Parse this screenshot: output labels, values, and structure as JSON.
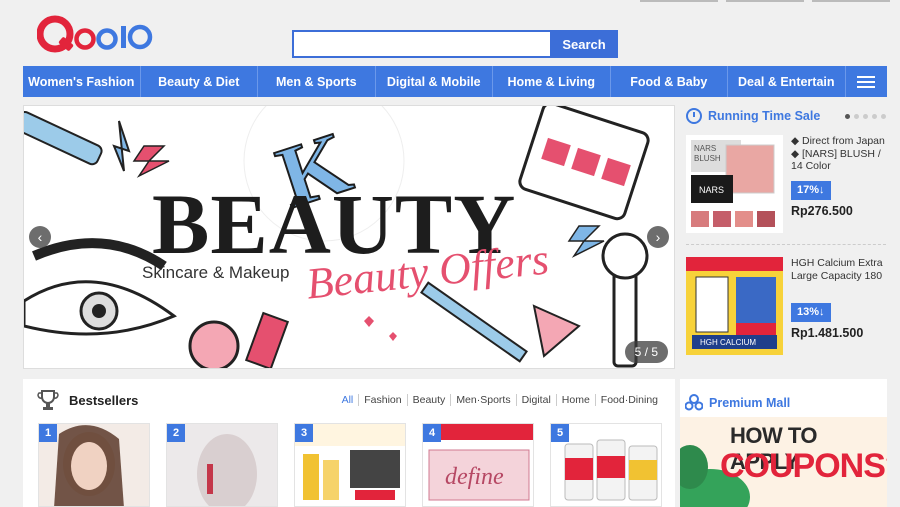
{
  "header": {
    "logo": "Qoo10",
    "search": {
      "value": "",
      "placeholder": "",
      "button_label": "Search"
    }
  },
  "nav": {
    "items": [
      "Women's Fashion",
      "Beauty & Diet",
      "Men & Sports",
      "Digital & Mobile",
      "Home & Living",
      "Food & Baby",
      "Deal & Entertain"
    ],
    "menu_icon": "hamburger-icon"
  },
  "banner": {
    "k_letter": "K",
    "title": "BEAUTY",
    "subtitle": "Skincare & Makeup",
    "offer": "Beauty Offers",
    "counter": "5 / 5"
  },
  "running_sale": {
    "title": "Running Time Sale",
    "items": [
      {
        "desc": "◆ Direct from Japan ◆ [NARS] BLUSH / 14 Color",
        "discount": "17%↓",
        "price": "Rp276.500",
        "img_text": "NARS BLUSH"
      },
      {
        "desc": "HGH Calcium Extra Large Capacity 180",
        "discount": "13%↓",
        "price": "Rp1.481.500",
        "img_text": "HGH CALCIUM"
      }
    ]
  },
  "bestsellers": {
    "title": "Bestsellers",
    "filters": [
      "All",
      "Fashion",
      "Beauty",
      "Men·Sports",
      "Digital",
      "Home",
      "Food·Dining"
    ],
    "cards": [
      {
        "rank": "1"
      },
      {
        "rank": "2"
      },
      {
        "rank": "3"
      },
      {
        "rank": "4",
        "label": "define"
      },
      {
        "rank": "5"
      }
    ]
  },
  "premium_mall": {
    "title": "Premium Mall",
    "line1": "HOW TO APPLY",
    "line2": "COUPONS?"
  },
  "colors": {
    "accent": "#3e78e0",
    "logo_red": "#e2243b",
    "price_badge": "#3e78e0"
  }
}
